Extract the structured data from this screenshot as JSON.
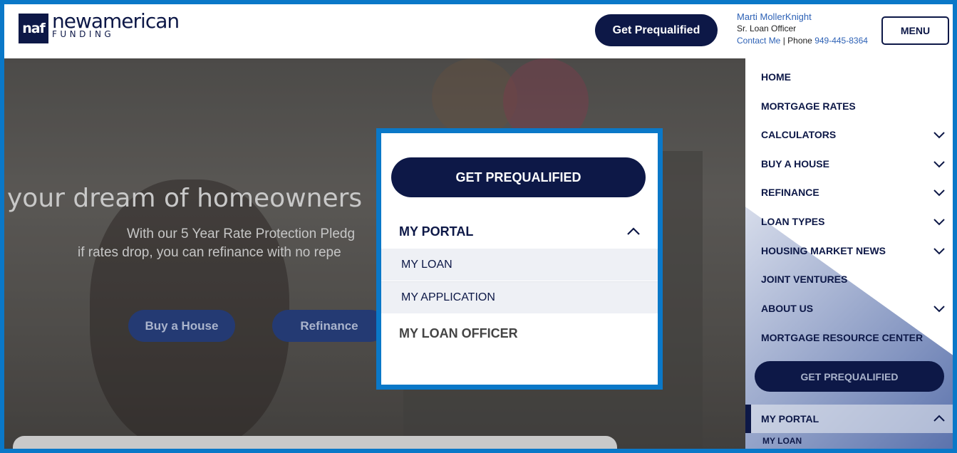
{
  "header": {
    "logo_mark": "naf",
    "logo_word": "newamerican",
    "logo_sub": "FUNDING",
    "cta_label": "Get Prequalified",
    "officer_name": "Marti MollerKnight",
    "officer_title": "Sr. Loan Officer",
    "contact_label": "Contact Me",
    "phone_prefix": " | Phone ",
    "phone": "949-445-8364",
    "menu_label": "MENU"
  },
  "hero": {
    "title": "your dream of homeowners",
    "subtitle_line1": "With our 5 Year Rate Protection Pledg",
    "subtitle_line2": "if rates drop, you can refinance with no repe",
    "buttons": [
      "Buy a House",
      "Refinance"
    ]
  },
  "sidebar": {
    "items": [
      {
        "label": "HOME",
        "has_chevron": false
      },
      {
        "label": "MORTGAGE RATES",
        "has_chevron": false
      },
      {
        "label": "CALCULATORS",
        "has_chevron": true
      },
      {
        "label": "BUY A HOUSE",
        "has_chevron": true
      },
      {
        "label": "REFINANCE",
        "has_chevron": true
      },
      {
        "label": "LOAN TYPES",
        "has_chevron": true
      },
      {
        "label": "HOUSING MARKET NEWS",
        "has_chevron": true
      },
      {
        "label": "JOINT VENTURES",
        "has_chevron": false
      },
      {
        "label": "ABOUT US",
        "has_chevron": true
      },
      {
        "label": "MORTGAGE RESOURCE CENTER",
        "has_chevron": false
      }
    ],
    "cta_label": "GET PREQUALIFIED",
    "portal_label": "MY PORTAL",
    "portal_first_item": "MY LOAN"
  },
  "popup": {
    "cta_label": "GET PREQUALIFIED",
    "portal_label": "MY PORTAL",
    "portal_items": [
      "MY LOAN",
      "MY APPLICATION"
    ],
    "loan_officer_label": "MY LOAN OFFICER"
  },
  "colors": {
    "brand_navy": "#0d1847",
    "highlight_blue": "#0a78c8",
    "link_blue": "#2e62b6"
  },
  "icons": [
    "chevron-down-icon",
    "chevron-up-icon"
  ]
}
